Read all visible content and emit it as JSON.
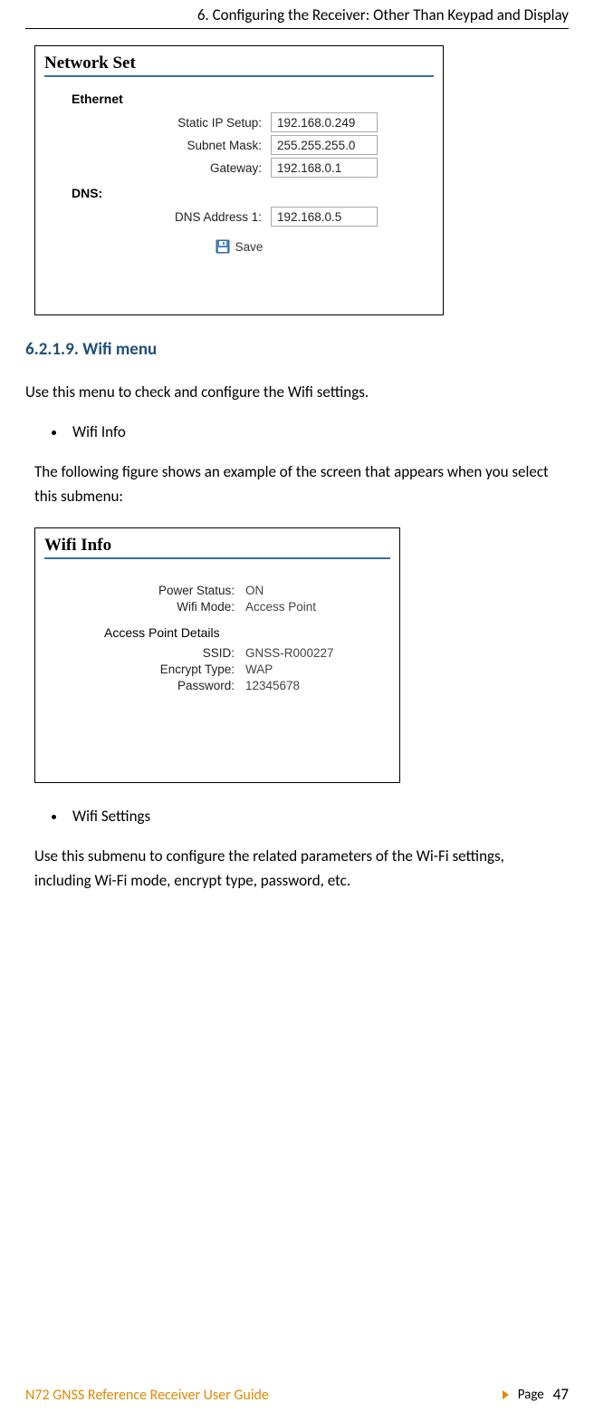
{
  "header": {
    "title": "6. Configuring the Receiver: Other Than Keypad and Display"
  },
  "figure1": {
    "title": "Network Set",
    "group1": "Ethernet",
    "rows": [
      {
        "label": "Static IP Setup:",
        "value": "192.168.0.249"
      },
      {
        "label": "Subnet Mask:",
        "value": "255.255.255.0"
      },
      {
        "label": "Gateway:",
        "value": "192.168.0.1"
      }
    ],
    "group2": "DNS:",
    "dns": {
      "label": "DNS Address 1:",
      "value": "192.168.0.5"
    },
    "save": "Save"
  },
  "section": {
    "number": "6.2.1.9.",
    "title": "Wifi menu",
    "intro": "Use this menu to check and configure the Wifi settings.",
    "bullet1": "Wifi Info",
    "para1": "The following figure shows an example of the screen that appears when you select this submenu:",
    "bullet2": "Wifi Settings",
    "para2": "Use this submenu to configure the related parameters of the Wi-Fi settings, including Wi-Fi mode, encrypt type, password, etc."
  },
  "figure2": {
    "title": "Wifi Info",
    "rows1": [
      {
        "label": "Power Status:",
        "value": "ON"
      },
      {
        "label": "Wifi Mode:",
        "value": "Access Point"
      }
    ],
    "group": "Access Point Details",
    "rows2": [
      {
        "label": "SSID:",
        "value": "GNSS-R000227"
      },
      {
        "label": "Encrypt Type:",
        "value": "WAP"
      },
      {
        "label": "Password:",
        "value": "12345678"
      }
    ]
  },
  "footer": {
    "left": "N72 GNSS Reference Receiver User Guide",
    "page_label": "Page",
    "page_num": "47"
  }
}
